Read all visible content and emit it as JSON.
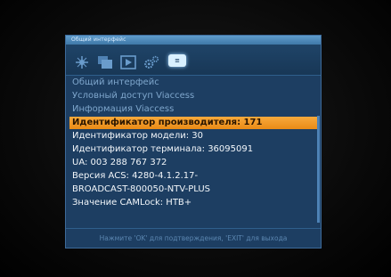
{
  "window": {
    "title": "Общий интерфейс"
  },
  "toolbar": {
    "icons": [
      {
        "name": "satellite-icon",
        "color": "#6a9ccc"
      },
      {
        "name": "channels-icon",
        "color": "#6a9ccc"
      },
      {
        "name": "media-play-icon",
        "color": "#6a9ccc"
      },
      {
        "name": "settings-gears-icon",
        "color": "#6a9ccc"
      },
      {
        "name": "ci-module-icon",
        "label": "≡",
        "selected": true
      }
    ]
  },
  "menu": {
    "items": [
      {
        "label": "Общий интерфейс",
        "style": "dim"
      },
      {
        "label": "Условный доступ Viaccess",
        "style": "dim"
      },
      {
        "label": "Информация Viaccess",
        "style": "dim"
      },
      {
        "label": "Идентификатор производителя: 171",
        "style": "highlighted"
      },
      {
        "label": "Идентификатор модели: 30",
        "style": "bright"
      },
      {
        "label": "Идентификатор терминала: 36095091",
        "style": "bright"
      },
      {
        "label": "UA:  003 288 767 372",
        "style": "bright"
      },
      {
        "label": "Версия ACS: 4280-4.1.2.17-",
        "style": "bright"
      },
      {
        "label": "BROADCAST-800050-NTV-PLUS",
        "style": "bright"
      },
      {
        "label": "Значение CAMLock: НТВ+",
        "style": "bright"
      }
    ]
  },
  "footer": {
    "hint": "Нажмите 'OK' для подтверждения, 'EXIT' для выхода"
  },
  "colors": {
    "panel": "#1d3e62",
    "highlight": "#f0961f",
    "title_bar": "#5f9ccc"
  }
}
